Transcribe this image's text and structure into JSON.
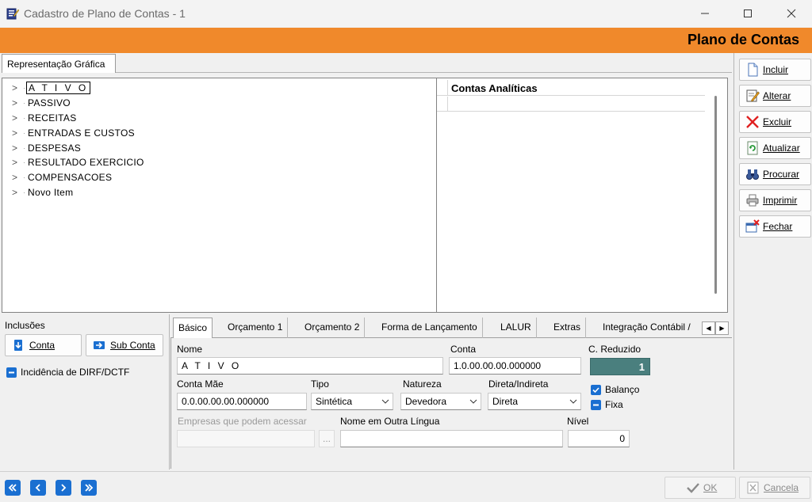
{
  "window": {
    "title": "Cadastro de Plano de Contas - 1",
    "icon": "edit-document-icon",
    "controls": [
      "minimize-icon",
      "maximize-icon",
      "close-icon"
    ]
  },
  "header": {
    "title": "Plano de Contas",
    "color": "#f0892b"
  },
  "tree": {
    "tab_label": "Representação Gráfica",
    "items": [
      {
        "label": "A T I V O",
        "selected": true
      },
      {
        "label": "PASSIVO"
      },
      {
        "label": "RECEITAS"
      },
      {
        "label": "ENTRADAS E CUSTOS"
      },
      {
        "label": "DESPESAS"
      },
      {
        "label": "RESULTADO EXERCICIO"
      },
      {
        "label": "COMPENSACOES"
      },
      {
        "label": "Novo Item"
      }
    ]
  },
  "grid": {
    "column_header": "Contas Analíticas"
  },
  "sidebar_buttons": {
    "incluir": "Incluir",
    "alterar": "Alterar",
    "excluir": "Excluir",
    "atualizar": "Atualizar",
    "procurar": "Procurar",
    "imprimir": "Imprimir",
    "fechar": "Fechar"
  },
  "inclusoes": {
    "label": "Inclusões",
    "conta_button": "Conta",
    "subconta_button": "Sub Conta",
    "dirf_checkbox": "Incidência de DIRF/DCTF"
  },
  "tabs": {
    "items": [
      "Básico",
      "Orçamento 1",
      "Orçamento 2",
      "Forma de Lançamento",
      "LALUR",
      "Extras",
      "Integração Contábil /"
    ],
    "active": "Básico"
  },
  "form": {
    "nome_label": "Nome",
    "nome_value": "A T I V O",
    "conta_label": "Conta",
    "conta_value": "1.0.00.00.00.000000",
    "reduzido_label": "C. Reduzido",
    "reduzido_value": "1",
    "conta_mae_label": "Conta Mãe",
    "conta_mae_value": "0.0.00.00.00.000000",
    "tipo_label": "Tipo",
    "tipo_value": "Sintética",
    "natureza_label": "Natureza",
    "natureza_value": "Devedora",
    "direta_label": "Direta/Indireta",
    "direta_value": "Direta",
    "balanco_label": "Balanço",
    "fixa_label": "Fixa",
    "empresas_label": "Empresas que podem acessar",
    "browse_label": "...",
    "outra_lingua_label": "Nome em Outra Língua",
    "nivel_label": "Nível",
    "nivel_value": "0"
  },
  "footer": {
    "ok_button": "OK",
    "cancela_button": "Cancela"
  }
}
